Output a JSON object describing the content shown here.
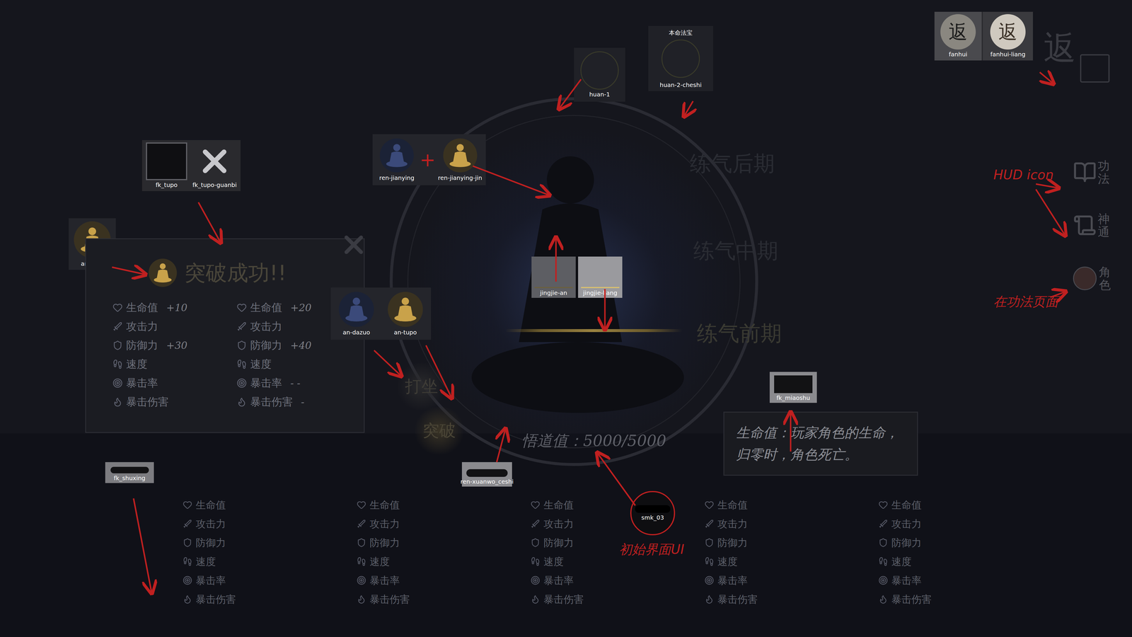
{
  "return_buttons": [
    {
      "label": "fanhui",
      "glyph": "返",
      "lit": false
    },
    {
      "label": "fanhui-liang",
      "glyph": "返",
      "lit": true
    }
  ],
  "corner_icon": {
    "glyph": "返"
  },
  "rings": [
    {
      "label": "huan-1",
      "header": ""
    },
    {
      "label": "huan-2-cheshi",
      "header": "本命法宝"
    }
  ],
  "figures": [
    {
      "label": "ren-jianying",
      "lit": false
    },
    {
      "label": "ren-jianying-jin",
      "lit": true
    }
  ],
  "figures_join": "+",
  "frame_tiles": [
    {
      "label": "fk_tupo",
      "kind": "frame"
    },
    {
      "label": "fk_tupo-guanbi",
      "kind": "close"
    }
  ],
  "left_tupo": {
    "label": "an-tupo"
  },
  "breakthrough_panel": {
    "title": "突破成功!!",
    "columns": [
      {
        "stats": [
          {
            "name": "生命值",
            "note": "+10"
          },
          {
            "name": "攻击力",
            "note": ""
          },
          {
            "name": "防御力",
            "note": "+30"
          },
          {
            "name": "速度",
            "note": ""
          },
          {
            "name": "暴击率",
            "note": ""
          },
          {
            "name": "暴击伤害",
            "note": ""
          }
        ]
      },
      {
        "stats": [
          {
            "name": "生命值",
            "note": "+20"
          },
          {
            "name": "攻击力",
            "note": ""
          },
          {
            "name": "防御力",
            "note": "+40"
          },
          {
            "name": "速度",
            "note": ""
          },
          {
            "name": "暴击率",
            "note": "- -"
          },
          {
            "name": "暴击伤害",
            "note": "-"
          }
        ]
      }
    ]
  },
  "action_tiles": [
    {
      "label": "an-dazuo",
      "lit": false
    },
    {
      "label": "an-tupo",
      "lit": true
    }
  ],
  "action_buttons": [
    "打坐",
    "突破"
  ],
  "realm_bars": [
    {
      "label": "jingjie-an",
      "lit": false
    },
    {
      "label": "jingjie-liang",
      "lit": true
    }
  ],
  "realms": [
    "练气后期",
    "练气中期",
    "练气前期"
  ],
  "insight": "悟道值：5000/5000",
  "misc_tiles": [
    {
      "label": "fk_miaoshu"
    },
    {
      "label": "fk_shuxing"
    },
    {
      "label": "ren-xuanwo_ceshi"
    },
    {
      "label": "smk_03"
    }
  ],
  "description": [
    "生命值：玩家角色的生命，",
    "归零时，角色死亡。"
  ],
  "stat_grid": [
    {
      "stats": [
        "生命值",
        "攻击力",
        "防御力",
        "速度",
        "暴击率",
        "暴击伤害"
      ]
    },
    {
      "stats": [
        "生命值",
        "攻击力",
        "防御力",
        "速度",
        "暴击率",
        "暴击伤害"
      ]
    },
    {
      "stats": [
        "生命值",
        "攻击力",
        "防御力",
        "速度",
        "暴击率",
        "暴击伤害"
      ]
    },
    {
      "stats": [
        "生命值",
        "攻击力",
        "防御力",
        "速度",
        "暴击率",
        "暴击伤害"
      ]
    },
    {
      "stats": [
        "生命值",
        "攻击力",
        "防御力",
        "速度",
        "暴击率",
        "暴击伤害"
      ]
    }
  ],
  "hud_icons": [
    {
      "label": "功法"
    },
    {
      "label": "神通"
    },
    {
      "label": "角色"
    }
  ],
  "annotations": {
    "hud": "HUD icon",
    "page": "在功法页面",
    "initial": "初始界面UI"
  }
}
